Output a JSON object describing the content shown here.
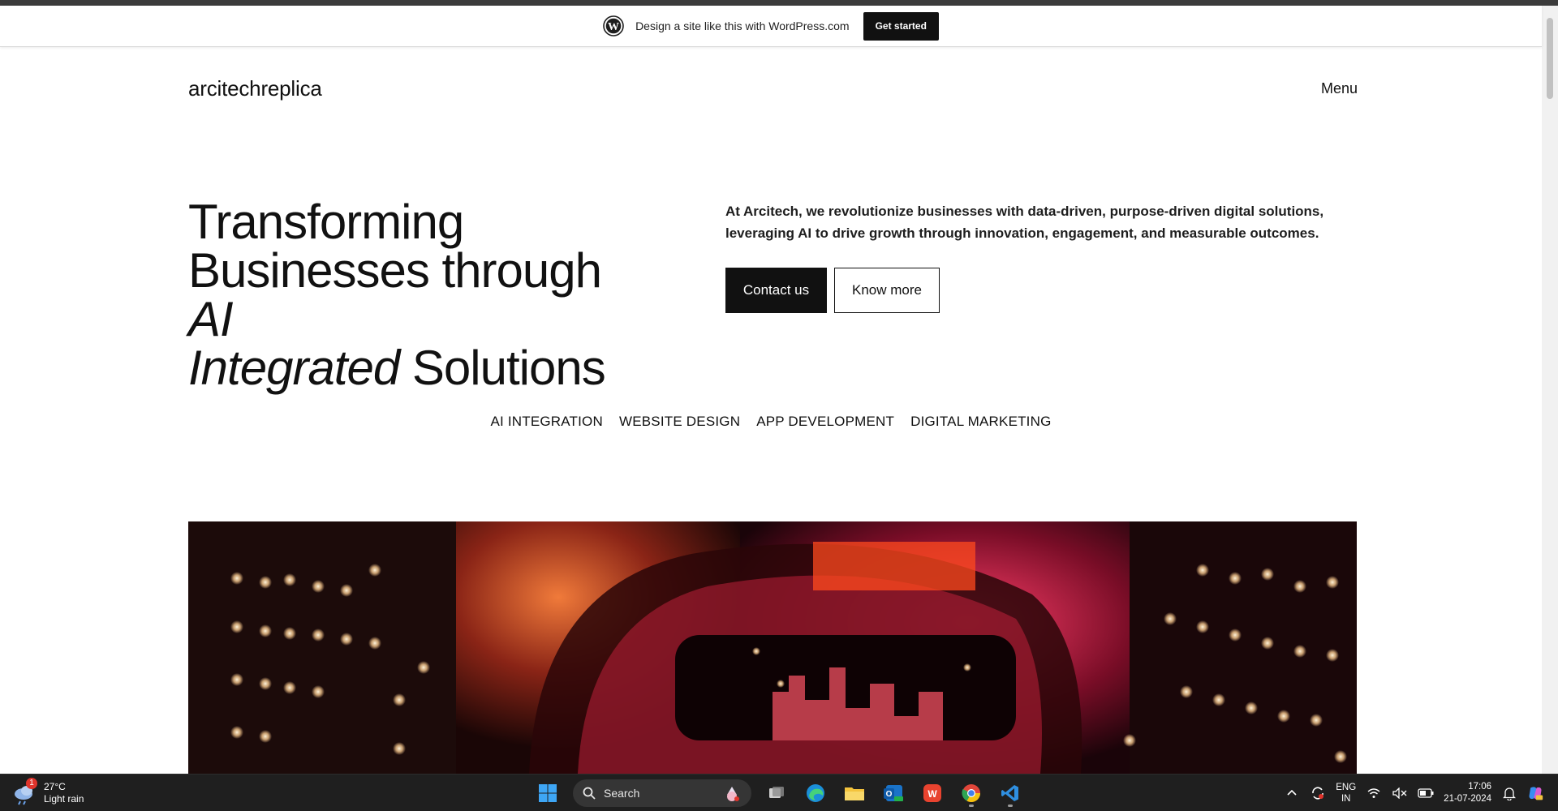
{
  "wordpress_bar": {
    "text": "Design a site like this with WordPress.com",
    "button": "Get started"
  },
  "site": {
    "title": "arcitechreplica",
    "menu_label": "Menu"
  },
  "hero": {
    "heading_line1": "Transforming",
    "heading_line2": "Businesses through",
    "heading_italic1": "AI",
    "heading_italic2": "Integrated",
    "heading_tail": " Solutions",
    "description": "At Arcitech, we revolutionize businesses with data-driven, purpose-driven digital solutions, leveraging AI to drive growth through innovation, engagement, and measurable outcomes.",
    "primary_button": "Contact us",
    "secondary_button": "Know more"
  },
  "services": [
    "AI INTEGRATION",
    "WEBSITE DESIGN",
    "APP DEVELOPMENT",
    "DIGITAL MARKETING"
  ],
  "taskbar": {
    "weather_temp": "27°C",
    "weather_desc": "Light rain",
    "weather_badge": "1",
    "search_placeholder": "Search",
    "lang_line1": "ENG",
    "lang_line2": "IN",
    "time": "17:06",
    "date": "21-07-2024"
  },
  "colors": {
    "accent_dark": "#111111",
    "taskbar": "#1f1f1f"
  }
}
